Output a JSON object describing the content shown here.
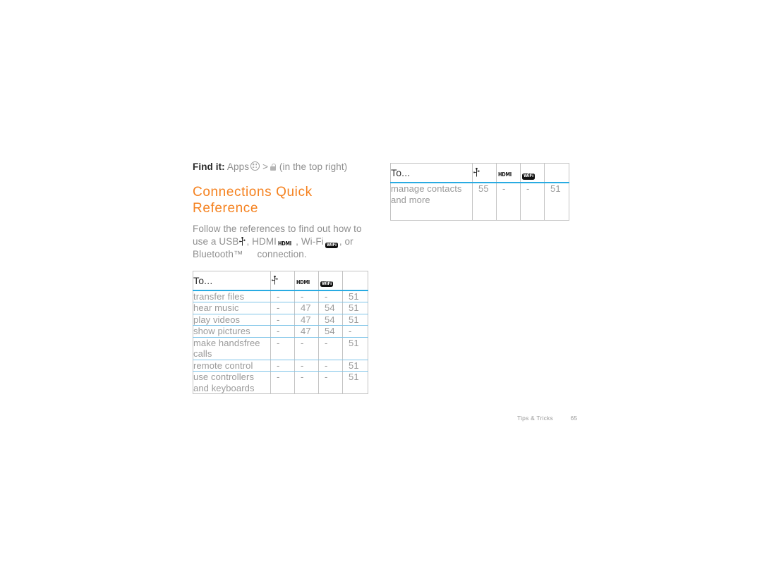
{
  "colors": {
    "heading_orange": "#F58220",
    "rule_blue": "#29ABE2",
    "row_divider_blue": "#7FC4E8",
    "border_grey": "#C3C3C3",
    "body_grey": "#8F8F8F",
    "dark_text": "#2F2F2F"
  },
  "find_it": {
    "label": "Find it:",
    "apps_label": "Apps",
    "separator": ">",
    "trailing": "(in the top right)",
    "apps_icon": "apps-grid-circle-icon",
    "target_icon": "lock-icon"
  },
  "heading": "Connections Quick Reference",
  "intro": {
    "line1": "Follow the references to find out how to",
    "line2_a": "use a USB",
    "line2_b": ", HDMI",
    "line2_c": ", Wi-Fi",
    "line2_d": ", or",
    "line3_a": "Bluetooth™",
    "line3_b": "connection.",
    "usb_icon": "usb-trident-icon",
    "hdmi_icon": "hdmi-logo-icon",
    "wifi_icon": "wifi-badge-icon"
  },
  "icons": {
    "usb": "usb-trident-icon",
    "hdmi": "hdmi-logo-icon",
    "wifi": "wifi-badge-icon",
    "hdmi_text": "HDMI",
    "wifi_text": "WiFi"
  },
  "table_left": {
    "headers": [
      "To...",
      "usb-trident-icon",
      "hdmi-logo-icon",
      "wifi-badge-icon",
      ""
    ],
    "rows": [
      {
        "to": "transfer files",
        "usb": "-",
        "hdmi": "-",
        "wifi": "-",
        "bt": "51"
      },
      {
        "to": "hear music",
        "usb": "-",
        "hdmi": "47",
        "wifi": "54",
        "bt": "51"
      },
      {
        "to": "play videos",
        "usb": "-",
        "hdmi": "47",
        "wifi": "54",
        "bt": "51"
      },
      {
        "to": "show pictures",
        "usb": "-",
        "hdmi": "47",
        "wifi": "54",
        "bt": "-"
      },
      {
        "to": "make handsfree calls",
        "usb": "-",
        "hdmi": "-",
        "wifi": "-",
        "bt": "51"
      },
      {
        "to": "remote control",
        "usb": "-",
        "hdmi": "-",
        "wifi": "-",
        "bt": "51"
      },
      {
        "to": "use controllers and keyboards",
        "usb": "-",
        "hdmi": "-",
        "wifi": "-",
        "bt": "51"
      }
    ]
  },
  "table_right": {
    "headers": [
      "To...",
      "usb-trident-icon",
      "hdmi-logo-icon",
      "wifi-badge-icon",
      ""
    ],
    "rows": [
      {
        "to": "manage contacts and more",
        "usb": "55",
        "hdmi": "-",
        "wifi": "-",
        "bt": "51"
      }
    ]
  },
  "footer": {
    "section": "Tips & Tricks",
    "page": "65"
  }
}
